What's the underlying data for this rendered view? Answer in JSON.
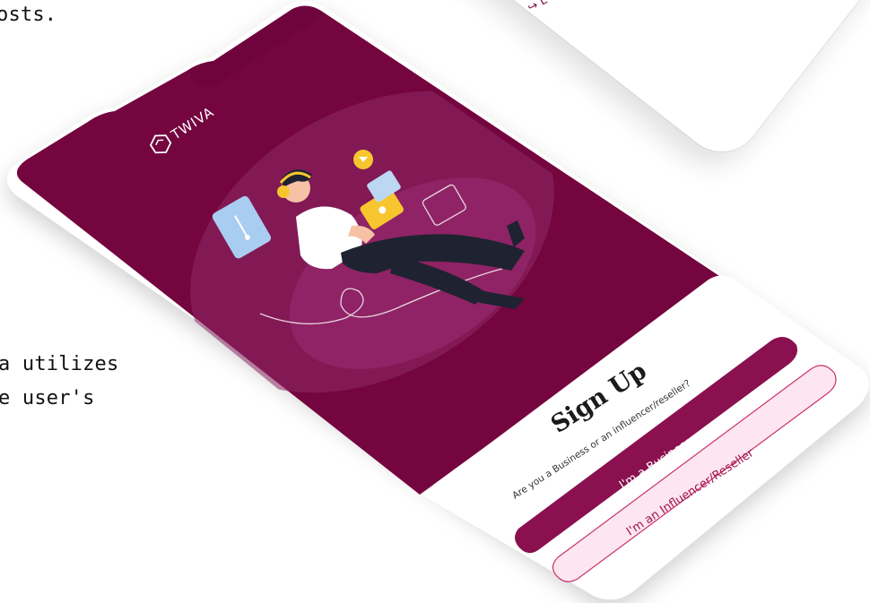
{
  "background": {
    "text_top": "osts.",
    "text_left_1": "a utilizes",
    "text_left_2": "e user's"
  },
  "phone2": {
    "item_icon": "logout-icon",
    "item_label": "L"
  },
  "app": {
    "brand": "TWIVA",
    "colors": {
      "primary": "#74053f",
      "primary_button": "#8a1050",
      "secondary_button_bg": "#fde6ef",
      "secondary_button_border": "#c9326d",
      "circle": "#8e2a66"
    },
    "signup": {
      "title": "Sign Up",
      "subtitle": "Are you a Business or an influencer/reseller?",
      "business_button": "I'm a Business",
      "influencer_button": "I'm an Influencer/Reseller"
    }
  }
}
